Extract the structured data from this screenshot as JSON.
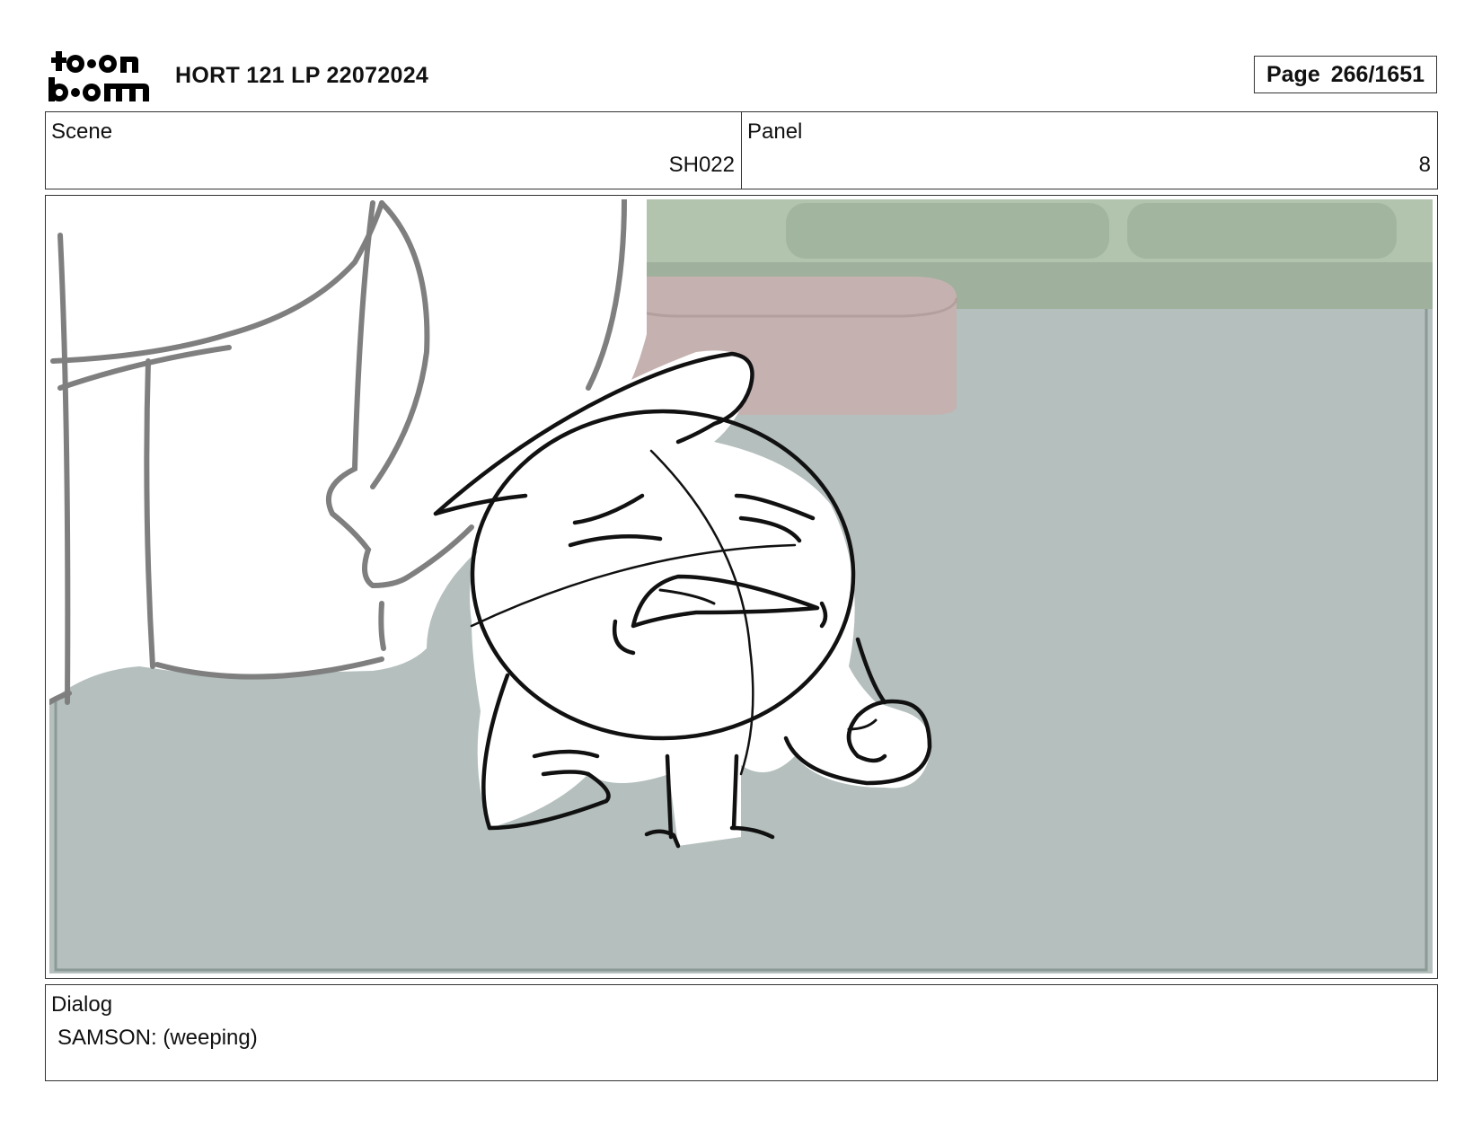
{
  "header": {
    "logo": {
      "line1": "toon",
      "line2": "boom"
    },
    "title": "HORT 121 LP 22072024",
    "page_label": "Page",
    "page_value": "266/1651"
  },
  "scene": {
    "label": "Scene",
    "value": "SH022"
  },
  "panel": {
    "label": "Panel",
    "value": "8"
  },
  "drawing": {
    "description_icon": "storyboard-sketch",
    "colors": {
      "floor": "#b4bfbe",
      "couch": "#a9bca6",
      "ottoman": "#c6b2b0",
      "ink": "#111111",
      "ghost_ink": "#808080"
    }
  },
  "dialog": {
    "label": "Dialog",
    "text": "SAMSON: (weeping)"
  }
}
